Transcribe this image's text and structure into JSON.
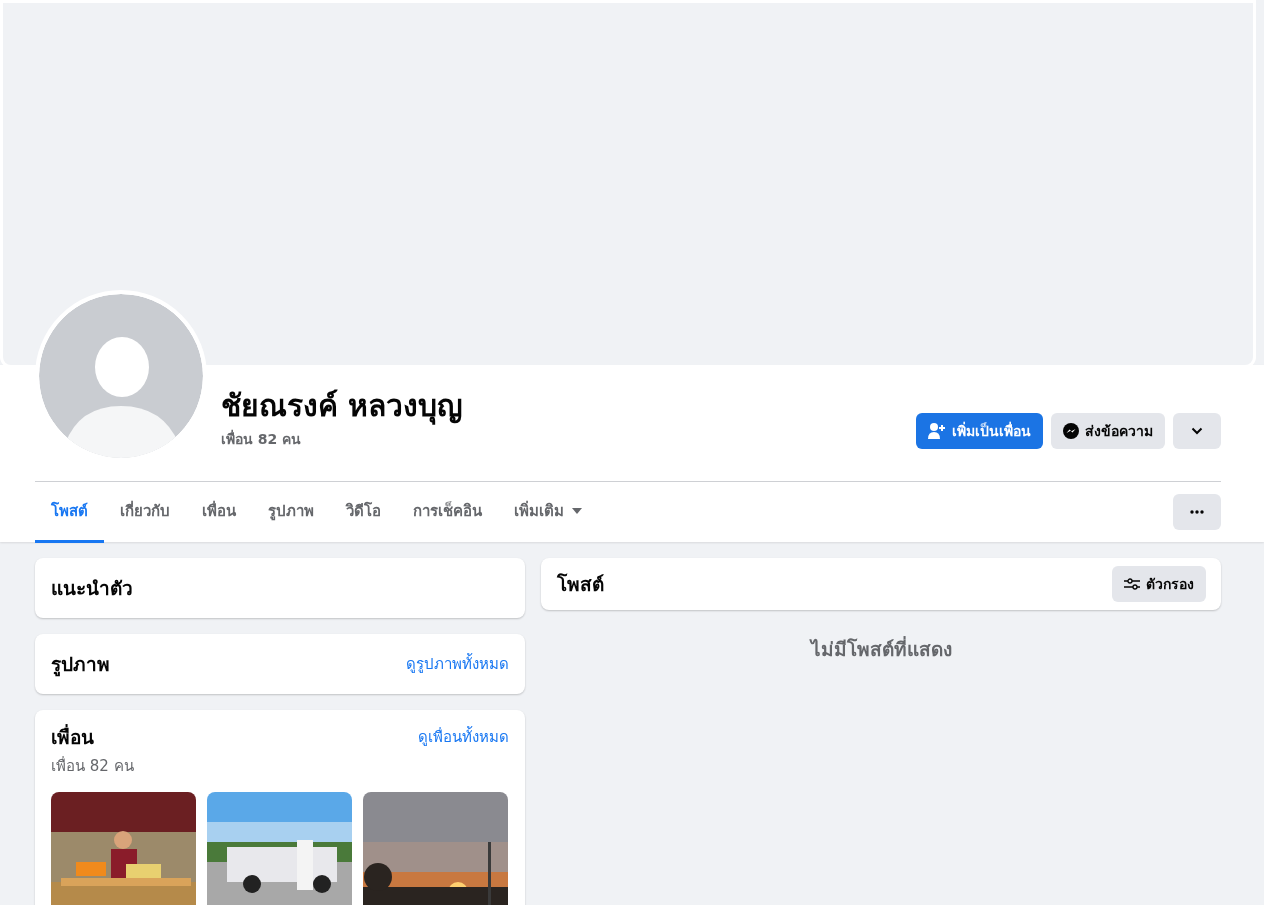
{
  "profile": {
    "name": "ชัยณรงค์ หลวงบุญ",
    "friend_count": "เพื่อน 82 คน"
  },
  "actions": [
    {
      "kind": "add_friend",
      "label": "เพิ่มเป็นเพื่อน"
    },
    {
      "kind": "message",
      "label": "ส่งข้อความ"
    },
    {
      "kind": "dropdown"
    }
  ],
  "tabs": [
    {
      "label": "โพสต์",
      "selected": true,
      "has_menu": false
    },
    {
      "label": "เกี่ยวกับ",
      "selected": false,
      "has_menu": false
    },
    {
      "label": "เพื่อน",
      "selected": false,
      "has_menu": false
    },
    {
      "label": "รูปภาพ",
      "selected": false,
      "has_menu": false
    },
    {
      "label": "วิดีโอ",
      "selected": false,
      "has_menu": false
    },
    {
      "label": "การเช็คอิน",
      "selected": false,
      "has_menu": false
    },
    {
      "label": "เพิ่มเติม",
      "selected": false,
      "has_menu": true
    }
  ],
  "intro": {
    "title": "แนะนำตัว"
  },
  "photos": {
    "title": "รูปภาพ",
    "link": "ดูรูปภาพทั้งหมด"
  },
  "friends": {
    "title": "เพื่อน",
    "count": "เพื่อน 82 คน",
    "link": "ดูเพื่อนทั้งหมด"
  },
  "posts": {
    "title": "โพสต์",
    "filter": "ตัวกรอง",
    "empty": "ไม่มีโพสต์ที่แสดง"
  }
}
